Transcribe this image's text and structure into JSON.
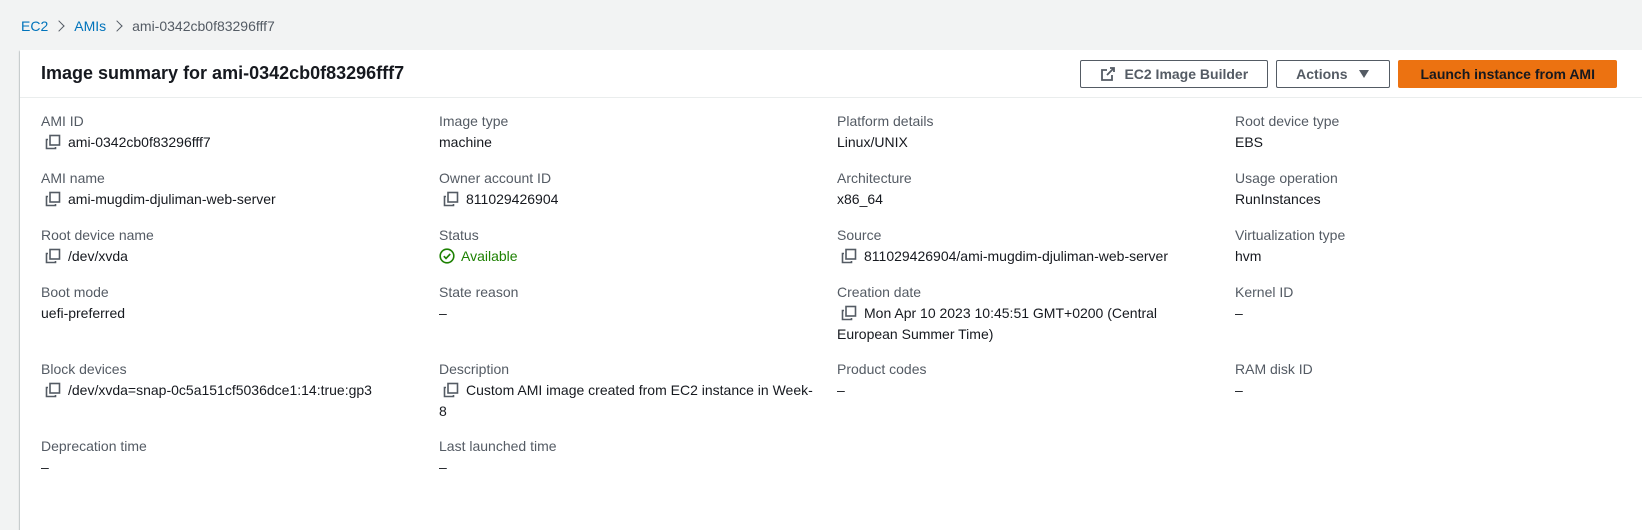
{
  "breadcrumb": {
    "items": [
      "EC2",
      "AMIs"
    ],
    "current": "ami-0342cb0f83296fff7"
  },
  "panel": {
    "title": "Image summary for ami-0342cb0f83296fff7",
    "buttons": {
      "image_builder": "EC2 Image Builder",
      "actions": "Actions",
      "launch": "Launch instance from AMI"
    }
  },
  "fields": {
    "ami_id": {
      "label": "AMI ID",
      "value": "ami-0342cb0f83296fff7"
    },
    "image_type": {
      "label": "Image type",
      "value": "machine"
    },
    "platform_details": {
      "label": "Platform details",
      "value": "Linux/UNIX"
    },
    "root_device_type": {
      "label": "Root device type",
      "value": "EBS"
    },
    "ami_name": {
      "label": "AMI name",
      "value": "ami-mugdim-djuliman-web-server"
    },
    "owner_account_id": {
      "label": "Owner account ID",
      "value": "811029426904"
    },
    "architecture": {
      "label": "Architecture",
      "value": "x86_64"
    },
    "usage_operation": {
      "label": "Usage operation",
      "value": "RunInstances"
    },
    "root_device_name": {
      "label": "Root device name",
      "value": "/dev/xvda"
    },
    "status": {
      "label": "Status",
      "value": "Available"
    },
    "source": {
      "label": "Source",
      "value": "811029426904/ami-mugdim-djuliman-web-server"
    },
    "virtualization_type": {
      "label": "Virtualization type",
      "value": "hvm"
    },
    "boot_mode": {
      "label": "Boot mode",
      "value": "uefi-preferred"
    },
    "state_reason": {
      "label": "State reason",
      "value": "–"
    },
    "creation_date": {
      "label": "Creation date",
      "value": "Mon Apr 10 2023 10:45:51 GMT+0200 (Central European Summer Time)"
    },
    "kernel_id": {
      "label": "Kernel ID",
      "value": "–"
    },
    "block_devices": {
      "label": "Block devices",
      "value": "/dev/xvda=snap-0c5a151cf5036dce1:14:true:gp3"
    },
    "description": {
      "label": "Description",
      "value": "Custom AMI image created from EC2 instance in Week-8"
    },
    "product_codes": {
      "label": "Product codes",
      "value": "–"
    },
    "ram_disk_id": {
      "label": "RAM disk ID",
      "value": "–"
    },
    "deprecation_time": {
      "label": "Deprecation time",
      "value": "–"
    },
    "last_launched_time": {
      "label": "Last launched time",
      "value": "–"
    }
  },
  "colors": {
    "link": "#0073bb",
    "primary_button": "#ec7211",
    "success": "#1d8102",
    "label": "#545b64"
  },
  "icons": {
    "copy": "copy-icon",
    "external": "external-link-icon",
    "caret": "caret-down-icon",
    "status": "check-circle-icon"
  }
}
